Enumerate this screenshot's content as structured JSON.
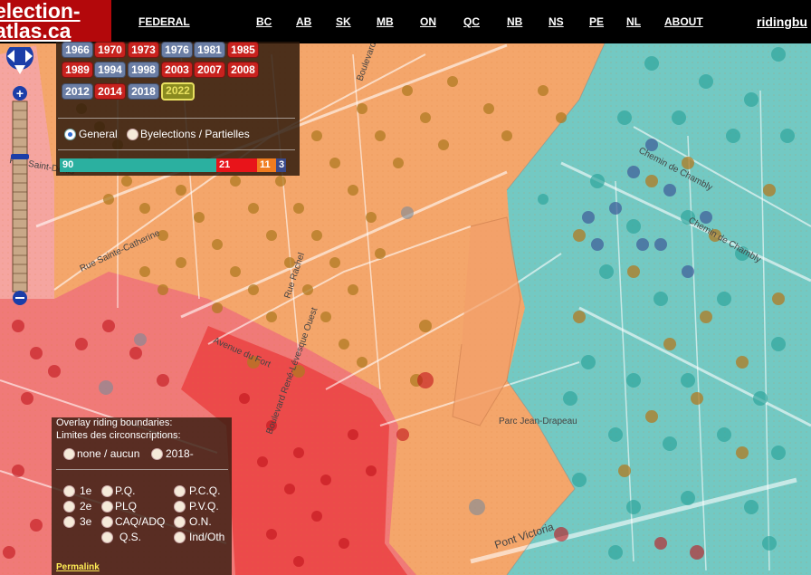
{
  "header": {
    "logo_line1": "election-",
    "logo_line2": "atlas.ca",
    "nav": [
      "FEDERAL",
      "BC",
      "AB",
      "SK",
      "MB",
      "ON",
      "QC",
      "NB",
      "NS",
      "PE",
      "NL",
      "ABOUT"
    ],
    "ridingbuilder": "ridingbu"
  },
  "years": {
    "row1": [
      "1966",
      "1970",
      "1973",
      "1976",
      "1981",
      "1985"
    ],
    "row2": [
      "1989",
      "1994",
      "1998",
      "2003",
      "2007",
      "2008"
    ],
    "row3": [
      "2012",
      "2014",
      "2018",
      "2022"
    ],
    "selected": "2022",
    "colors": {
      "liberal": "#c8221e",
      "conservative": "#6b7ea5",
      "selected": "#e8e060"
    }
  },
  "election_type": {
    "general": "General",
    "byelections": "Byelections / Partielles",
    "selected": "General"
  },
  "seats": {
    "segments": [
      {
        "party": "CAQ",
        "count": "90",
        "color": "#2bb0a0"
      },
      {
        "party": "PLQ",
        "count": "21",
        "color": "#e8141a"
      },
      {
        "party": "QS",
        "count": "11",
        "color": "#f07c1f"
      },
      {
        "party": "PQ",
        "count": "3",
        "color": "#3a4a8a"
      }
    ]
  },
  "overlay": {
    "title1": "Overlay riding boundaries:",
    "title2": "Limites des circonscriptions:",
    "none": "none / aucun",
    "y2018": "2018-",
    "ranks": [
      "1e",
      "2e",
      "3e"
    ],
    "parties_col1": [
      "P.Q.",
      "PLQ",
      "CAQ/ADQ",
      "Q.S."
    ],
    "parties_col2": [
      "P.C.Q.",
      "P.V.Q.",
      "O.N.",
      "Ind/Oth"
    ],
    "permalink": "Permalink"
  },
  "map_labels": {
    "parc": "Parc Jean-Drapeau",
    "chambly1": "Chemin de Chambly",
    "chambly2": "Chemin de Chambly",
    "victoria": "Pont Victoria",
    "rene": "Boulevard René-Lévesque Ouest",
    "dufort": "Avenue du Fort",
    "rachel": "Rue Rachel",
    "stdenis": "Rue Saint-Denis",
    "stlaurent": "Boulevard Saint-Laurent",
    "stcath": "Rue Sainte-Catherine"
  }
}
